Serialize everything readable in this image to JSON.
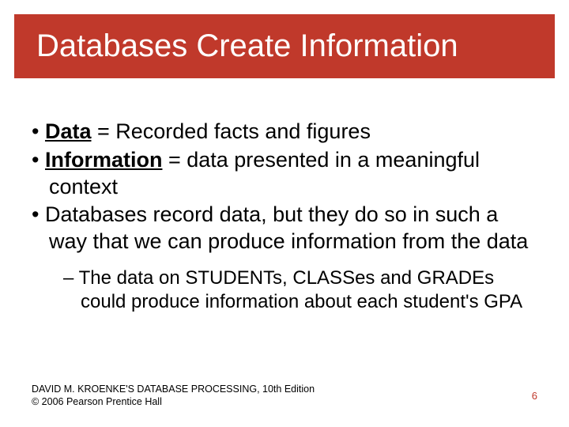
{
  "title": "Databases Create Information",
  "bullets": {
    "b1_term": "Data",
    "b1_rest": " = Recorded facts and figures",
    "b2_term": "Information",
    "b2_rest": " = data presented in a meaningful context",
    "b3": "Databases record data, but they do so in such a way that we can produce information from the data"
  },
  "sub": {
    "s1": "The data on STUDENTs, CLASSes and GRADEs could produce information about each student's GPA"
  },
  "footer": {
    "line1": "DAVID M. KROENKE'S DATABASE PROCESSING, 10th Edition",
    "line2": "© 2006 Pearson Prentice Hall"
  },
  "page": "6"
}
